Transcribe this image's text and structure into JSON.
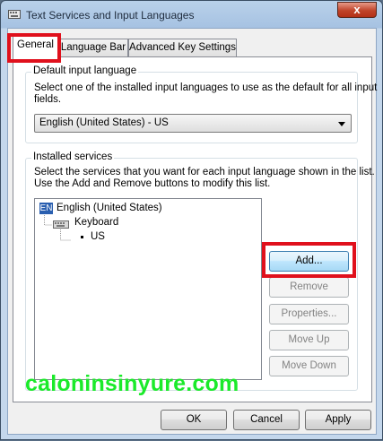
{
  "window": {
    "title": "Text Services and Input Languages",
    "close_label": "x"
  },
  "tabs": [
    {
      "label": "General"
    },
    {
      "label": "Language Bar"
    },
    {
      "label": "Advanced Key Settings"
    }
  ],
  "default_input": {
    "group_label": "Default input language",
    "description_line1": "Select one of the installed input languages to use as the default for all input",
    "description_line2": "fields.",
    "selected": "English (United States) - US"
  },
  "installed_services": {
    "group_label": "Installed services",
    "description_line1": "Select the services that you want for each input language shown in the list.",
    "description_line2": "Use the Add and Remove buttons to modify this list.",
    "tree": {
      "language_badge": "EN",
      "language": "English (United States)",
      "category": "Keyboard",
      "item": "US"
    },
    "buttons": {
      "add": "Add...",
      "remove": "Remove",
      "properties": "Properties...",
      "move_up": "Move Up",
      "move_down": "Move Down"
    }
  },
  "watermark": "caloninsinyure.com",
  "footer": {
    "ok": "OK",
    "cancel": "Cancel",
    "apply": "Apply"
  },
  "colors": {
    "highlight": "#e0101c",
    "watermark": "#1bea2a",
    "badge": "#2a5fb0"
  }
}
